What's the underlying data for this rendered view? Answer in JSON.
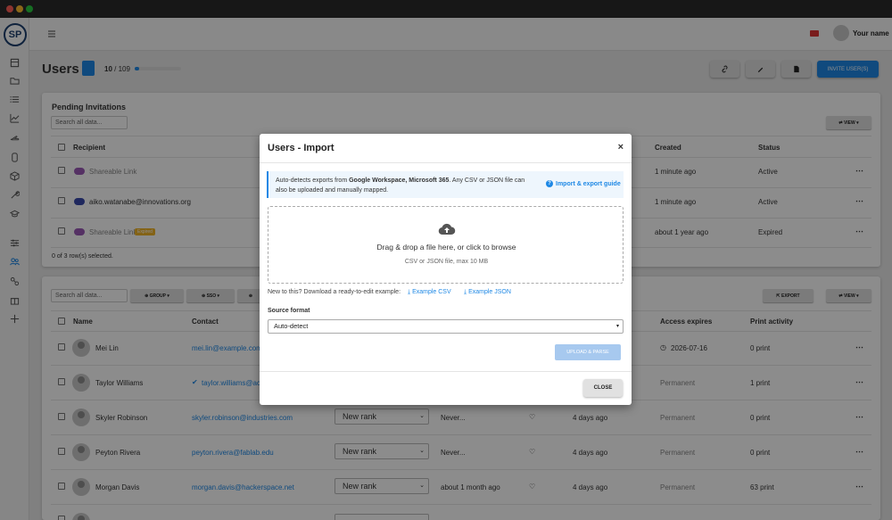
{
  "header": {
    "username": "Your name"
  },
  "page": {
    "title": "Users",
    "count_current": "10",
    "count_sep": " / ",
    "count_total": "109",
    "seat_usage_fraction": 0.09,
    "invite_label": "INVITE USER(S)"
  },
  "pending": {
    "title": "Pending Invitations",
    "search_placeholder": "Search all data...",
    "view_label": "⇄ VIEW ▾",
    "headers": {
      "recipient": "Recipient",
      "created": "Created",
      "status": "Status"
    },
    "rows": [
      {
        "recipient": "Shareable Link",
        "created": "1 minute ago",
        "status": "Active",
        "chip_color": "#9b59b6"
      },
      {
        "recipient": "aiko.watanabe@innovations.org",
        "created": "1 minute ago",
        "status": "Active",
        "chip_color": "#3949ab"
      },
      {
        "recipient": "Shareable Link",
        "tag": "Expired",
        "created": "about 1 year ago",
        "status": "Expired",
        "chip_color": "#9b59b6"
      }
    ],
    "selected_text": "0 of 3 row(s) selected."
  },
  "users": {
    "search_placeholder": "Search all data...",
    "filters": {
      "group": "GROUP",
      "sso": "SSO"
    },
    "export_label": "EXPORT",
    "view_label": "⇄ VIEW ▾",
    "headers": {
      "name": "Name",
      "contact": "Contact",
      "access_expires": "Access expires",
      "print_activity": "Print activity"
    },
    "rows": [
      {
        "name": "Mei Lin",
        "contact": "mei.lin@example.com",
        "expires": "2026-07-16",
        "prints": "0 print"
      },
      {
        "name": "Taylor Williams",
        "contact": "taylor.williams@ac",
        "expires": "Permanent",
        "prints": "1 print"
      },
      {
        "name": "Skyler Robinson",
        "contact": "skyler.robinson@industries.com",
        "rank": "New rank",
        "last": "Never...",
        "seen": "4 days ago",
        "expires": "Permanent",
        "prints": "0 print"
      },
      {
        "name": "Peyton Rivera",
        "contact": "peyton.rivera@fablab.edu",
        "rank": "New rank",
        "last": "Never...",
        "seen": "4 days ago",
        "expires": "Permanent",
        "prints": "0 print"
      },
      {
        "name": "Morgan Davis",
        "contact": "morgan.davis@hackerspace.net",
        "rank": "New rank",
        "last": "about 1 month ago",
        "seen": "4 days ago",
        "expires": "Permanent",
        "prints": "63 print"
      }
    ]
  },
  "modal": {
    "title": "Users - Import",
    "close_x": "×",
    "info_prefix": "Auto-detects exports from ",
    "info_bold": "Google Workspace, Microsoft 365",
    "info_suffix": ". Any CSV or JSON file can also be uploaded and manually mapped.",
    "guide_label": "Import & export guide",
    "dropzone_main": "Drag & drop a file here, or click to browse",
    "dropzone_sub": "CSV or JSON file, max 10 MB",
    "examples_label": "New to this? Download a ready-to-edit example:",
    "example_csv": "Example CSV",
    "example_json": "Example JSON",
    "source_label": "Source format",
    "source_value": "Auto-detect",
    "upload_label": "UPLOAD & PARSE",
    "close_label": "CLOSE"
  }
}
